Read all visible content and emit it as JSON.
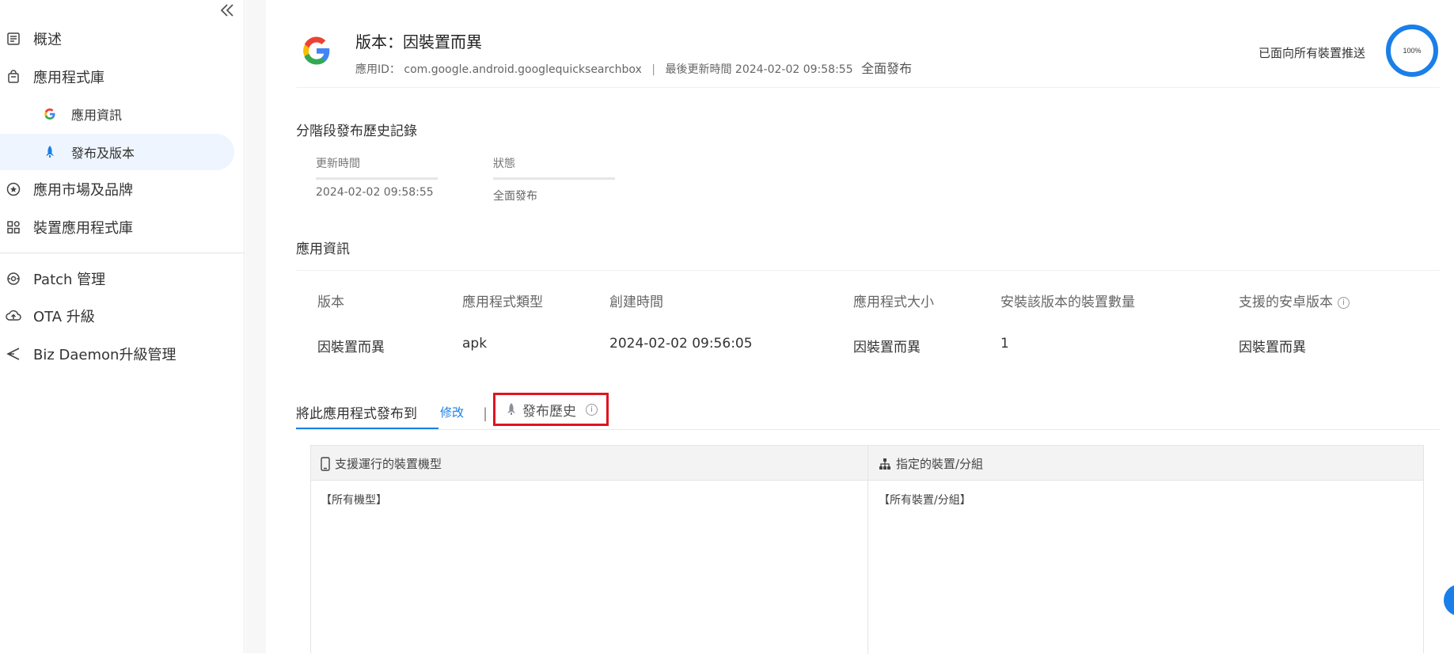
{
  "sidebar": {
    "collapse_icon": "double-chevron-left-icon",
    "items": [
      {
        "label": "概述",
        "icon": "list-doc-icon"
      },
      {
        "label": "應用程式庫",
        "icon": "shopping-bag-icon"
      },
      {
        "label": "應用資訊",
        "icon": "google-g-icon"
      },
      {
        "label": "發布及版本",
        "icon": "rocket-icon"
      },
      {
        "label": "應用市場及品牌",
        "icon": "star-circle-icon"
      },
      {
        "label": "裝置應用程式庫",
        "icon": "apps-grid-icon"
      },
      {
        "label": "Patch 管理",
        "icon": "patch-icon"
      },
      {
        "label": "OTA 升級",
        "icon": "cloud-upload-icon"
      },
      {
        "label": "Biz Daemon升級管理",
        "icon": "send-icon"
      }
    ]
  },
  "header": {
    "title": "版本：因裝置而異",
    "app_id_label": "應用ID：",
    "app_id": "com.google.android.googlequicksearchbox",
    "separator": "|",
    "updated_label": "最後更新時間",
    "updated_time": "2024-02-02 09:58:55",
    "release_status": "全面發布",
    "push_label": "已面向所有裝置推送",
    "push_percent_text": "100%",
    "push_percent": 100,
    "accent_color": "#1a7fe8"
  },
  "staged_history": {
    "title": "分階段發布歷史記錄",
    "columns": [
      "更新時間",
      "狀態"
    ],
    "rows": [
      [
        "2024-02-02 09:58:55",
        "全面發布"
      ]
    ]
  },
  "app_info": {
    "title": "應用資訊",
    "columns": [
      "版本",
      "應用程式類型",
      "創建時間",
      "應用程式大小",
      "安裝該版本的裝置數量",
      "支援的安卓版本"
    ],
    "info_icon_text": "i",
    "values": [
      "因裝置而異",
      "apk",
      "2024-02-02 09:56:05",
      "因裝置而異",
      "1",
      "因裝置而異"
    ]
  },
  "tabs": {
    "publish_to": "將此應用程式發布到",
    "edit": "修改",
    "pipe": "|",
    "history": "發布歷史",
    "history_icon": "rocket-icon",
    "info_icon_text": "i"
  },
  "target_table": {
    "columns": [
      {
        "label": "支援運行的裝置機型",
        "icon": "phone-icon"
      },
      {
        "label": "指定的裝置/分組",
        "icon": "org-tree-icon"
      }
    ],
    "values": [
      "【所有機型】",
      "【所有裝置/分組】"
    ]
  }
}
